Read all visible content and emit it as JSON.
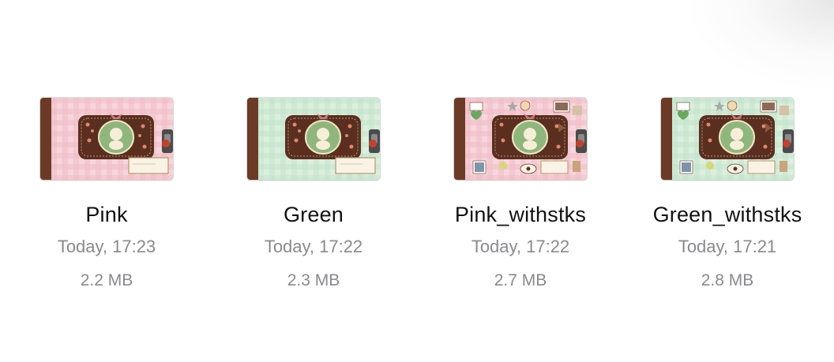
{
  "files": [
    {
      "name": "Pink",
      "date": "Today, 17:23",
      "size": "2.2 MB",
      "theme": "pink",
      "stickers": false
    },
    {
      "name": "Green",
      "date": "Today, 17:22",
      "size": "2.3 MB",
      "theme": "green",
      "stickers": false
    },
    {
      "name": "Pink_withstks",
      "date": "Today, 17:22",
      "size": "2.7 MB",
      "theme": "pink",
      "stickers": true
    },
    {
      "name": "Green_withstks",
      "date": "Today, 17:21",
      "size": "2.8 MB",
      "theme": "green",
      "stickers": true
    }
  ],
  "colors": {
    "pink_base": "#f6d6db",
    "pink_check": "#f0bcc6",
    "green_base": "#dcefdf",
    "green_check": "#c3e3c9",
    "spine": "#6b3b27",
    "label_brown": "#5a2f20",
    "oval_green": "#8fb77b",
    "name_text": "#111111",
    "meta_text": "#8a8a8e"
  }
}
